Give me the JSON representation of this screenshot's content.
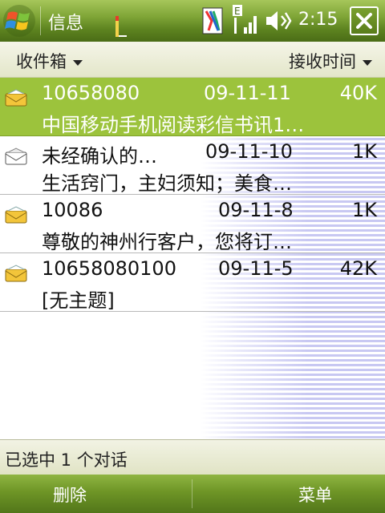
{
  "titlebar": {
    "app_title": "信息",
    "time": "2:15",
    "close_label": "✕",
    "signal_badge": "E"
  },
  "header": {
    "folder": "收件箱",
    "sort": "接收时间"
  },
  "messages": [
    {
      "sender": "10658080",
      "date": "09-11-11",
      "size": "40K",
      "subject": "中国移动手机阅读彩信书讯1…",
      "selected": true
    },
    {
      "sender": "未经确认的…",
      "date": "09-11-10",
      "size": "1K",
      "subject": "生活窍门，主妇须知；美食…",
      "selected": false
    },
    {
      "sender": "10086",
      "date": "09-11-8",
      "size": "1K",
      "subject": "尊敬的神州行客户，您将订…",
      "selected": false
    },
    {
      "sender": "10658080100",
      "date": "09-11-5",
      "size": "42K",
      "subject": "[无主题]",
      "selected": false
    }
  ],
  "status": {
    "text": "已选中 1 个对话"
  },
  "softkeys": {
    "left": "删除",
    "right": "菜单"
  },
  "colors": {
    "selected_row": "#9cc33c",
    "titlebar": "#6b9628",
    "list_stripe": "#c8c8f2"
  }
}
